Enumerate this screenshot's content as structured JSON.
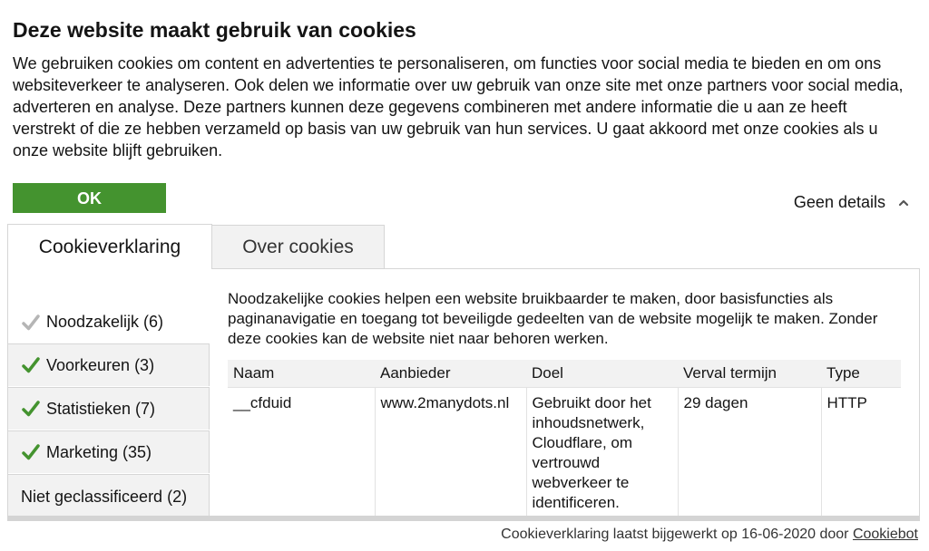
{
  "banner": {
    "title": "Deze website maakt gebruik van cookies",
    "intro": "We gebruiken cookies om content en advertenties te personaliseren, om functies voor social media te bieden en om ons websiteverkeer te analyseren. Ook delen we informatie over uw gebruik van onze site met onze partners voor social media, adverteren en analyse. Deze partners kunnen deze gegevens combineren met andere informatie die u aan ze heeft verstrekt of die ze hebben verzameld op basis van uw gebruik van hun services. U gaat akkoord met onze cookies als u onze website blijft gebruiken.",
    "ok_label": "OK",
    "details_toggle": "Geen details"
  },
  "tabs": [
    {
      "label": "Cookieverklaring"
    },
    {
      "label": "Over cookies"
    }
  ],
  "categories": [
    {
      "label": "Noodzakelijk (6)",
      "checked": true,
      "disabled": true
    },
    {
      "label": "Voorkeuren (3)",
      "checked": true
    },
    {
      "label": "Statistieken (7)",
      "checked": true
    },
    {
      "label": "Marketing (35)",
      "checked": true
    },
    {
      "label": "Niet geclassificeerd (2)"
    }
  ],
  "description": "Noodzakelijke cookies helpen een website bruikbaarder te maken, door basisfuncties als paginanavigatie en toegang tot beveiligde gedeelten van de website mogelijk te maken. Zonder deze cookies kan de website niet naar behoren werken.",
  "table": {
    "headers": [
      "Naam",
      "Aanbieder",
      "Doel",
      "Verval termijn",
      "Type"
    ],
    "rows": [
      [
        "__cfduid",
        "www.2manydots.nl",
        "Gebruikt door het inhoudsnetwerk, Cloudflare, om vertrouwd webverkeer te identificeren.",
        "29 dagen",
        "HTTP"
      ]
    ]
  },
  "footer": {
    "text": "Cookieverklaring laatst bijgewerkt op 16-06-2020 door ",
    "link": "Cookiebot"
  },
  "colors": {
    "accent_green": "#44932f",
    "check_disabled": "#b5b5b5"
  }
}
